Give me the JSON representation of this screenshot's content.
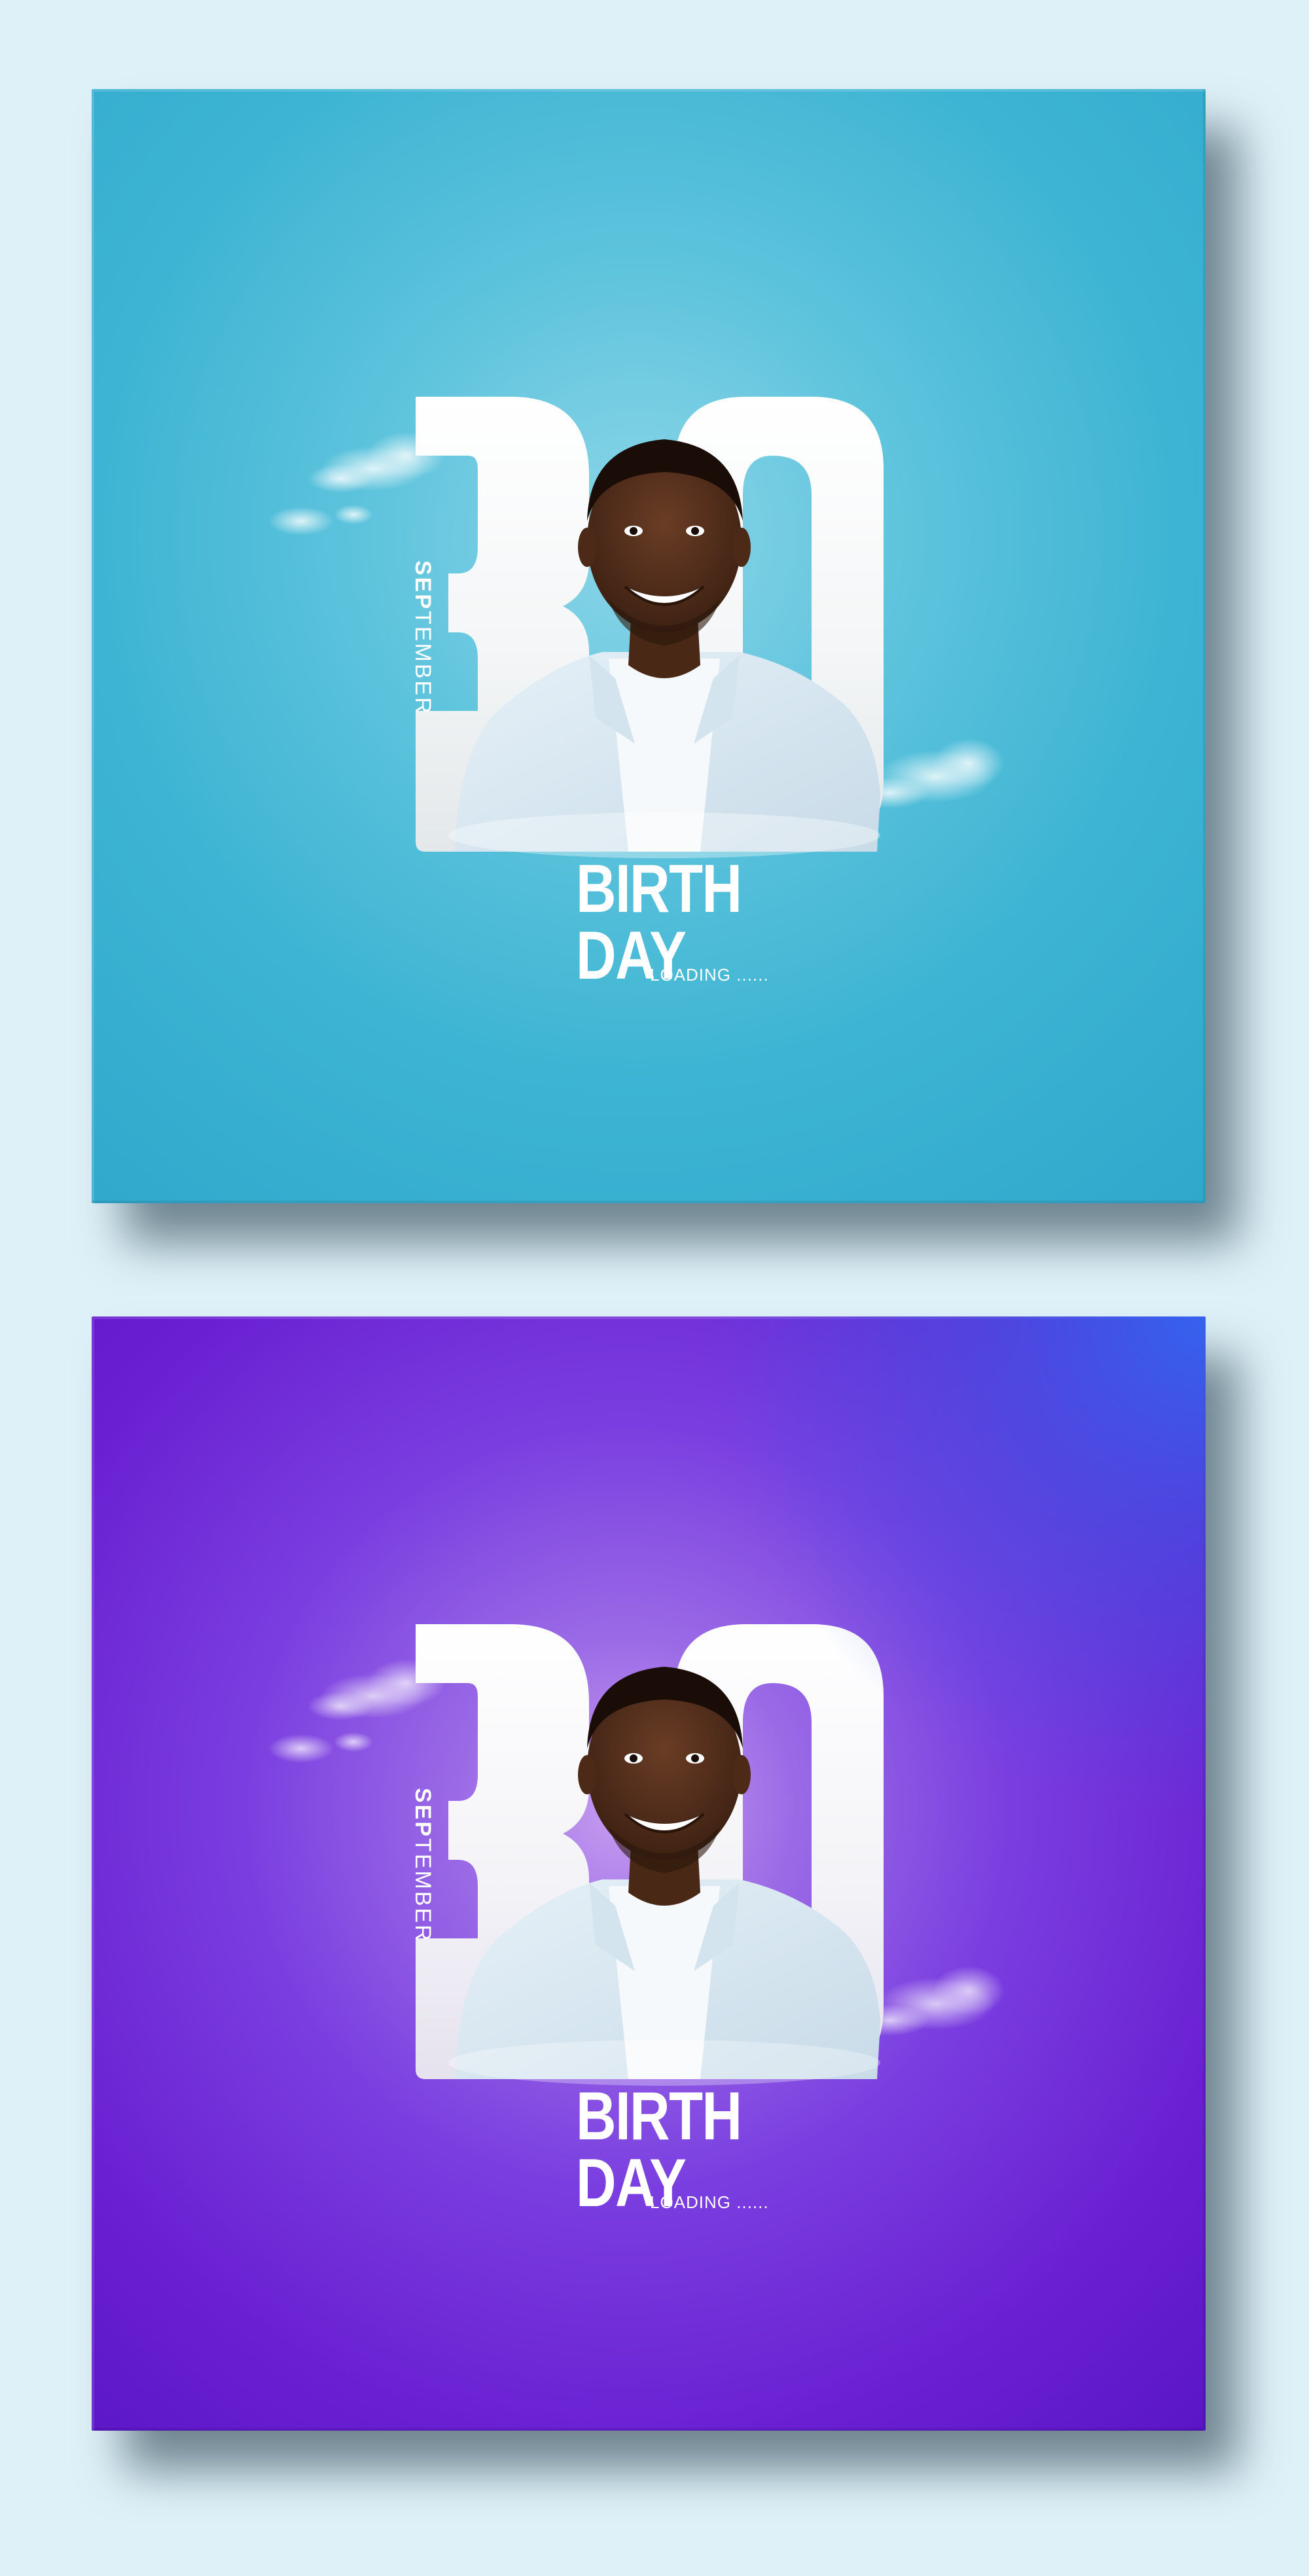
{
  "posters": [
    {
      "theme": "blue",
      "number": "30",
      "month": {
        "bold": "SEP",
        "light": "TEMBER"
      },
      "title_line1": "BIRTH",
      "title_line2": "DAY",
      "subtitle": "LOADING ......"
    },
    {
      "theme": "purple",
      "number": "30",
      "month": {
        "bold": "SEP",
        "light": "TEMBER"
      },
      "title_line1": "BIRTH",
      "title_line2": "DAY",
      "subtitle": "LOADING ......"
    }
  ],
  "colors": {
    "page_background": "#dff1f8",
    "blue_card": "#3db4d3",
    "purple_card": "#6a20d2",
    "purple_corner_accent": "#3366f0",
    "number_fill": "#ffffff",
    "text": "#ffffff"
  }
}
